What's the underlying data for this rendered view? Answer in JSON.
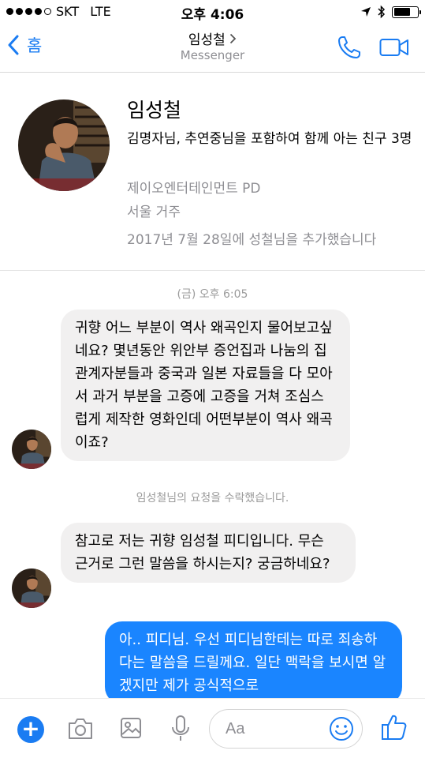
{
  "status_bar": {
    "carrier": "SKT",
    "network": "LTE",
    "time": "오후 4:06"
  },
  "header": {
    "back_label": "홈",
    "title": "임성철 ",
    "subtitle": "Messenger"
  },
  "profile": {
    "name": "임성철",
    "mutual_friends": "김명자님, 추연중님을 포함하여 함께 아는 친구 3명",
    "work": "제이오엔터테인먼트 PD",
    "lives": "서울 거주",
    "added": "2017년 7월 28일에 성철님을 추가했습니다"
  },
  "chat": {
    "timestamp": "(금) 오후 6:05",
    "messages": [
      {
        "from": "them",
        "text": "귀향 어느 부분이 역사 왜곡인지 물어보고싶네요? 몇년동안 위안부 증언집과 나눔의 집 관계자분들과 중국과 일본 자료들을 다 모아서 과거 부분을 고증에 고증을 거쳐 조심스럽게 제작한 영화인데 어떤부분이 역사 왜곡이죠?"
      },
      {
        "from": "them",
        "text": "참고로 저는 귀향 임성철 피디입니다. 무슨 근거로 그런 말씀을 하시는지? 궁금하네요?"
      },
      {
        "from": "me",
        "text": "아.. 피디님. 우선 피디님한테는 따로 죄송하다는 말씀을 드릴께요. 일단 맥락을 보시면 알겠지만 제가 공식적으로"
      }
    ],
    "system_notice": "임성철님의 요청을 수락했습니다."
  },
  "composer": {
    "placeholder": "Aa"
  },
  "colors": {
    "accent": "#1a7cf2",
    "outgoing_bubble": "#1a85ff",
    "incoming_bubble": "#f1f0f0"
  }
}
